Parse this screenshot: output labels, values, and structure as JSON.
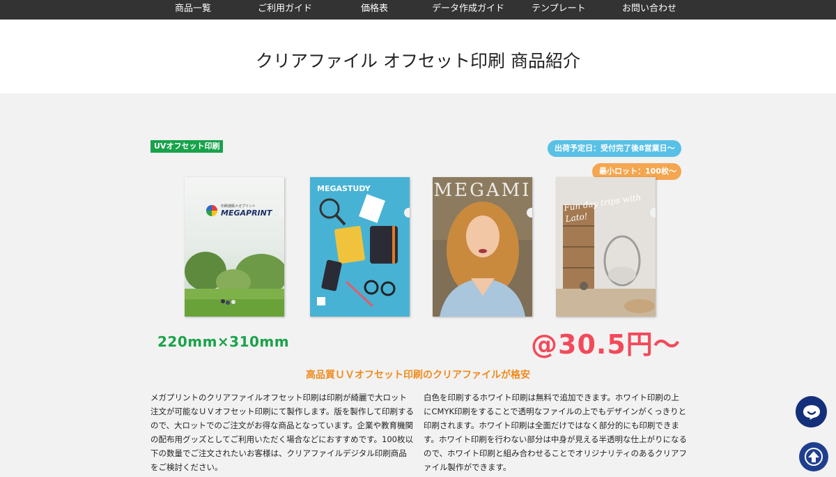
{
  "nav": {
    "items": [
      "商品一覧",
      "ご利用ガイド",
      "価格表",
      "データ作成ガイド",
      "テンプレート",
      "お問い合わせ"
    ]
  },
  "page": {
    "title": "クリアファイル オフセット印刷 商品紹介"
  },
  "badges": {
    "uv": "UVオフセット印刷",
    "shipping": "出荷予定日：受付完了後8営業日〜",
    "min_lot": "最小ロット：100枚〜"
  },
  "products": [
    {
      "brand": "MEGAPRINT",
      "subtitle": "印刷通販メガプリント"
    },
    {
      "brand": "MEGASTUDY"
    },
    {
      "brand": "MEGAMI"
    },
    {
      "script": "Fun day trips with Lato!"
    }
  ],
  "size": "220mm×310mm",
  "price": "@30.5円〜",
  "headline": "高品質ＵＶオフセット印刷のクリアファイルが格安",
  "body": {
    "left": "メガプリントのクリアファイルオフセット印刷は印刷が綺麗で大ロット注文が可能なＵＶオフセット印刷にて製作します。版を製作して印刷するので、大ロットでのご注文がお得な商品となっています。企業や教育機関の配布用グッズとしてご利用いただく場合などにおすすめです。100枚以下の数量でご注文されたいお客様は、クリアファイルデジタル印刷商品をご検討ください。",
    "right": "白色を印刷するホワイト印刷は無料で追加できます。ホワイト印刷の上にCMYK印刷をすることで透明なファイルの上でもデザインがくっきりと印刷されます。ホワイト印刷は全面だけではなく部分的にも印刷できます。ホワイト印刷を行わない部分は中身が見える半透明な仕上がりになるので、ホワイト印刷と組み合わせることでオリジナリティのあるクリアファイル製作ができます。"
  },
  "colors": {
    "nav_bg": "#333333",
    "green": "#18a24a",
    "blue_pill": "#59c0e6",
    "orange_pill": "#f4a650",
    "price_red": "#f24a5a",
    "headline_orange": "#f08a1c",
    "chat_navy": "#15307a"
  },
  "icons": {
    "chat": "chat-bubble-icon",
    "scroll_top": "arrow-up-icon"
  }
}
